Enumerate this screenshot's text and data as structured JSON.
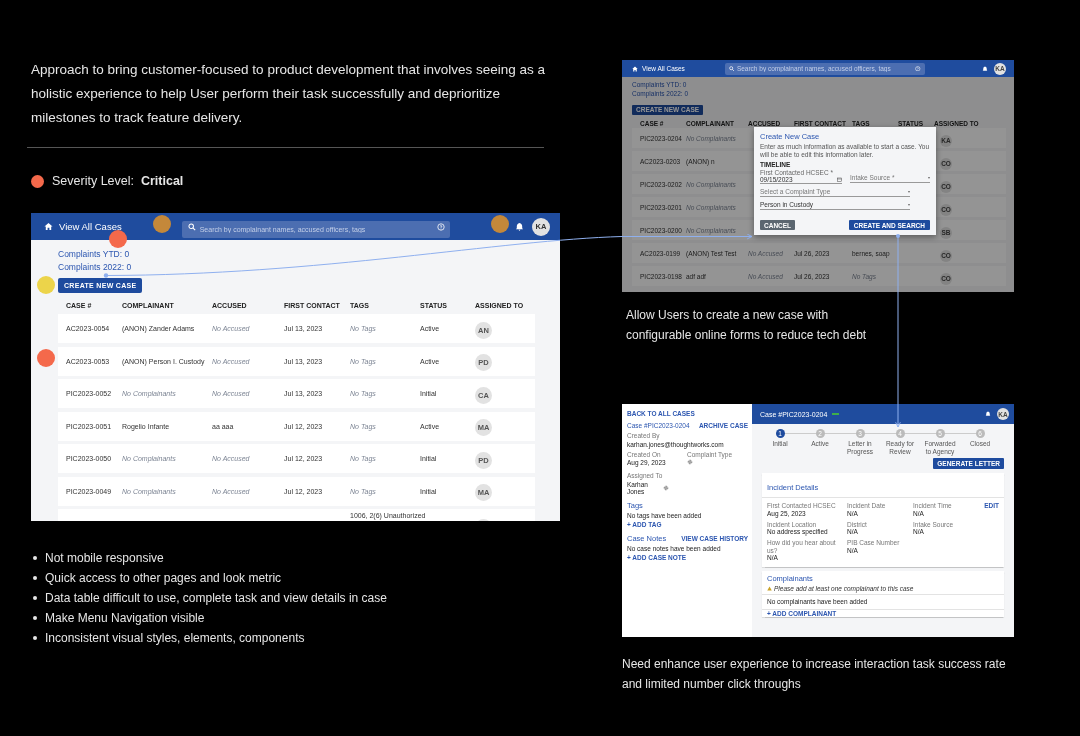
{
  "intro": "Approach to bring customer-focused to product development that involves seeing as a holistic experience to help User perform their task successfully and deprioritize milestones to track feature delivery.",
  "severity": {
    "text": "Severity Level:  **Critical**",
    "color": "#f4694b"
  },
  "main_screen": {
    "title": "View All Cases",
    "search_placeholder": "Search by complainant names, accused officers, tags",
    "avatar": "KA",
    "stats": [
      "Complaints YTD: 0",
      "Complaints 2022: 0"
    ],
    "create_button": "CREATE NEW CASE",
    "columns": [
      "CASE #",
      "COMPLAINANT",
      "ACCUSED",
      "FIRST CONTACT",
      "TAGS",
      "STATUS",
      "ASSIGNED TO"
    ],
    "rows": [
      {
        "cells": [
          {
            "text": "AC2023-0054",
            "empty": false
          },
          {
            "text": "(ANON) Zander Adams",
            "empty": false
          },
          {
            "text": "No Accused",
            "empty": true
          },
          {
            "text": "Jul 13, 2023",
            "empty": false
          },
          {
            "text": "No Tags",
            "empty": true
          },
          {
            "text": "Active",
            "empty": false
          }
        ],
        "assigned": "AN"
      },
      {
        "cells": [
          {
            "text": "AC2023-0053",
            "empty": false
          },
          {
            "text": "(ANON) Person I. Custody",
            "empty": false
          },
          {
            "text": "No Accused",
            "empty": true
          },
          {
            "text": "Jul 13, 2023",
            "empty": false
          },
          {
            "text": "No Tags",
            "empty": true
          },
          {
            "text": "Active",
            "empty": false
          }
        ],
        "assigned": "PD"
      },
      {
        "cells": [
          {
            "text": "PIC2023-0052",
            "empty": false
          },
          {
            "text": "No Complainants",
            "empty": true
          },
          {
            "text": "No Accused",
            "empty": true
          },
          {
            "text": "Jul 13, 2023",
            "empty": false
          },
          {
            "text": "No Tags",
            "empty": true
          },
          {
            "text": "Initial",
            "empty": false
          }
        ],
        "assigned": "CA"
      },
      {
        "cells": [
          {
            "text": "PIC2023-0051",
            "empty": false
          },
          {
            "text": "Rogelio Infante",
            "empty": false
          },
          {
            "text": "aa aaa",
            "empty": false
          },
          {
            "text": "Jul 12, 2023",
            "empty": false
          },
          {
            "text": "No Tags",
            "empty": true
          },
          {
            "text": "Active",
            "empty": false
          }
        ],
        "assigned": "MA"
      },
      {
        "cells": [
          {
            "text": "PIC2023-0050",
            "empty": false
          },
          {
            "text": "No Complainants",
            "empty": true
          },
          {
            "text": "No Accused",
            "empty": true
          },
          {
            "text": "Jul 12, 2023",
            "empty": false
          },
          {
            "text": "No Tags",
            "empty": true
          },
          {
            "text": "Initial",
            "empty": false
          }
        ],
        "assigned": "PD"
      },
      {
        "cells": [
          {
            "text": "PIC2023-0049",
            "empty": false
          },
          {
            "text": "No Complainants",
            "empty": true
          },
          {
            "text": "No Accused",
            "empty": true
          },
          {
            "text": "Jul 12, 2023",
            "empty": false
          },
          {
            "text": "No Tags",
            "empty": true
          },
          {
            "text": "Initial",
            "empty": false
          }
        ],
        "assigned": "MA"
      }
    ],
    "partial_row_tags": "1006, 2(6) Unauthorized"
  },
  "markers": [
    {
      "color": "#c4883a"
    },
    {
      "color": "#f4694b"
    },
    {
      "color": "#ecd44a"
    },
    {
      "color": "#f4694b"
    },
    {
      "color": "#c4883a"
    }
  ],
  "bullets": [
    "Not mobile responsive",
    "Quick access to other pages and look metric",
    "Data table difficult to use, complete task and view details in case",
    "Make Menu Navigation visible",
    "Inconsistent visual styles, elements, components"
  ],
  "modal_screen": {
    "title": "View All Cases",
    "search_placeholder": "Search by complainant names, accused officers, tags",
    "avatar": "KA",
    "stats": [
      "Complaints YTD: 0",
      "Complaints 2022: 0"
    ],
    "create_button": "CREATE NEW CASE",
    "columns": [
      "CASE #",
      "COMPLAINANT",
      "ACCUSED",
      "FIRST CONTACT",
      "TAGS",
      "STATUS",
      "ASSIGNED TO"
    ],
    "rows": [
      {
        "cells": [
          {
            "text": "PIC2023-0204",
            "empty": false
          },
          {
            "text": "No Complainants",
            "empty": true
          },
          null,
          null,
          null,
          null
        ],
        "assigned": "KA"
      },
      {
        "cells": [
          {
            "text": "AC2023-0203",
            "empty": false
          },
          {
            "text": "(ANON) n",
            "empty": false
          },
          null,
          null,
          null,
          null
        ],
        "assigned": "CO"
      },
      {
        "cells": [
          {
            "text": "PIC2023-0202",
            "empty": false
          },
          {
            "text": "No Complainants",
            "empty": true
          },
          null,
          null,
          null,
          null
        ],
        "assigned": "CO"
      },
      {
        "cells": [
          {
            "text": "PIC2023-0201",
            "empty": false
          },
          {
            "text": "No Complainants",
            "empty": true
          },
          null,
          null,
          null,
          null
        ],
        "assigned": "CO"
      },
      {
        "cells": [
          {
            "text": "PIC2023-0200",
            "empty": false
          },
          {
            "text": "No Complainants",
            "empty": true
          },
          null,
          null,
          null,
          null
        ],
        "assigned": "SB"
      },
      {
        "cells": [
          {
            "text": "AC2023-0199",
            "empty": false
          },
          {
            "text": "(ANON) Test Test",
            "empty": false
          },
          {
            "text": "No Accused",
            "empty": true
          },
          {
            "text": "Jul 26, 2023",
            "empty": false
          },
          {
            "text": "bernes, soap",
            "empty": false
          },
          null
        ],
        "assigned": "CO"
      },
      {
        "cells": [
          {
            "text": "PIC2023-0198",
            "empty": false
          },
          {
            "text": "adf adf",
            "empty": false
          },
          {
            "text": "No Accused",
            "empty": true
          },
          {
            "text": "Jul 26, 2023",
            "empty": false
          },
          {
            "text": "No Tags",
            "empty": true
          },
          null
        ],
        "assigned": "CO"
      }
    ],
    "modal": {
      "title": "Create New Case",
      "description": "Enter as much information as available to start a case. You will be able to edit this information later.",
      "section": "TIMELINE",
      "date_label": "First Contacted HCSEC *",
      "date_value": "09/15/2023",
      "intake_placeholder": "Intake Source *",
      "complaint_type_placeholder": "Select a Complaint Type",
      "custody_value": "Person in Custody",
      "cancel": "CANCEL",
      "submit": "CREATE AND SEARCH"
    }
  },
  "modal_caption": "Allow Users to create a new case with configurable online forms to reduce tech debt",
  "detail_screen": {
    "back_link": "BACK TO ALL CASES",
    "case_title": "Case #PIC2023-0204",
    "archive": "ARCHIVE CASE",
    "created_by_label": "Created By",
    "created_by": "karhan.jones@thoughtworks.com",
    "created_on_label": "Created On",
    "created_on": "Aug 29, 2023",
    "complaint_type_label": "Complaint Type",
    "assigned_label": "Assigned To",
    "assigned": "Karhan Jones",
    "tags_title": "Tags",
    "tags_empty": "No tags have been added",
    "add_tag": "+ ADD TAG",
    "notes_title": "Case Notes",
    "history": "VIEW CASE HISTORY",
    "notes_empty": "No case notes have been added",
    "add_note": "+ ADD CASE NOTE",
    "header_title": "Case #PIC2023-0204",
    "avatar": "KA",
    "steps": [
      {
        "number": "1",
        "label": "Initial",
        "selected": true
      },
      {
        "number": "2",
        "label": "Active",
        "selected": false
      },
      {
        "number": "3",
        "label": "Letter in Progress",
        "selected": false
      },
      {
        "number": "4",
        "label": "Ready for Review",
        "selected": false
      },
      {
        "number": "5",
        "label": "Forwarded to Agency",
        "selected": false
      },
      {
        "number": "6",
        "label": "Closed",
        "selected": false
      }
    ],
    "generate": "GENERATE LETTER",
    "incident_title": "Incident Details",
    "edit": "EDIT",
    "fields": [
      {
        "label": "First Contacted HCSEC",
        "value": "Aug 25, 2023"
      },
      {
        "label": "Incident Date",
        "value": "N/A"
      },
      {
        "label": "Incident Time",
        "value": "N/A"
      },
      {
        "label": "Incident Location",
        "value": "No address specified"
      },
      {
        "label": "District",
        "value": "N/A"
      },
      {
        "label": "Intake Source",
        "value": "N/A"
      },
      {
        "label": "How did you hear about us?",
        "value": "N/A"
      },
      {
        "label": "PIB Case Number",
        "value": "N/A"
      }
    ],
    "complainants_title": "Complainants",
    "warning": "Please add at least one complainant to this case",
    "complainants_empty": "No complainants have been added",
    "add_complainant": "+ ADD COMPLAINANT"
  },
  "detail_caption": "Need enhance user experience to increase interaction task success rate and limited number click throughs"
}
